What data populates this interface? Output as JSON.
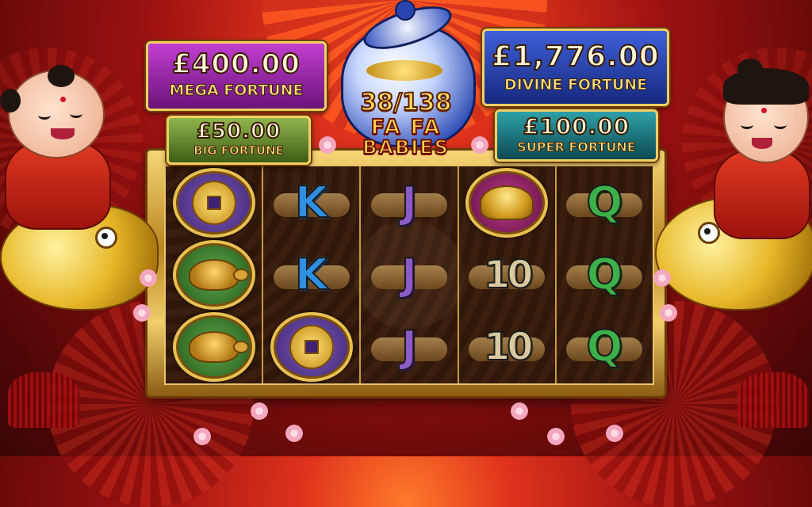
{
  "jackpots": {
    "mega": {
      "amount": "£400.00",
      "label": "MEGA FORTUNE"
    },
    "big": {
      "amount": "£50.00",
      "label": "BIG FORTUNE"
    },
    "divine": {
      "amount": "£1,776.00",
      "label": "DIVINE FORTUNE"
    },
    "super": {
      "amount": "£100.00",
      "label": "SUPER FORTUNE"
    }
  },
  "counter": "38/138",
  "logo": {
    "line1": "FA FA",
    "line2": "BABIES"
  },
  "reels": [
    [
      "coin-symbol",
      "turtle-symbol",
      "turtle-symbol"
    ],
    [
      "K",
      "K",
      "coin-symbol"
    ],
    [
      "J",
      "J",
      "J"
    ],
    [
      "ingot-symbol",
      "10",
      "10"
    ],
    [
      "Q",
      "Q",
      "Q"
    ]
  ],
  "letters": {
    "k": "K",
    "j": "J",
    "q": "Q",
    "ten": "10"
  }
}
